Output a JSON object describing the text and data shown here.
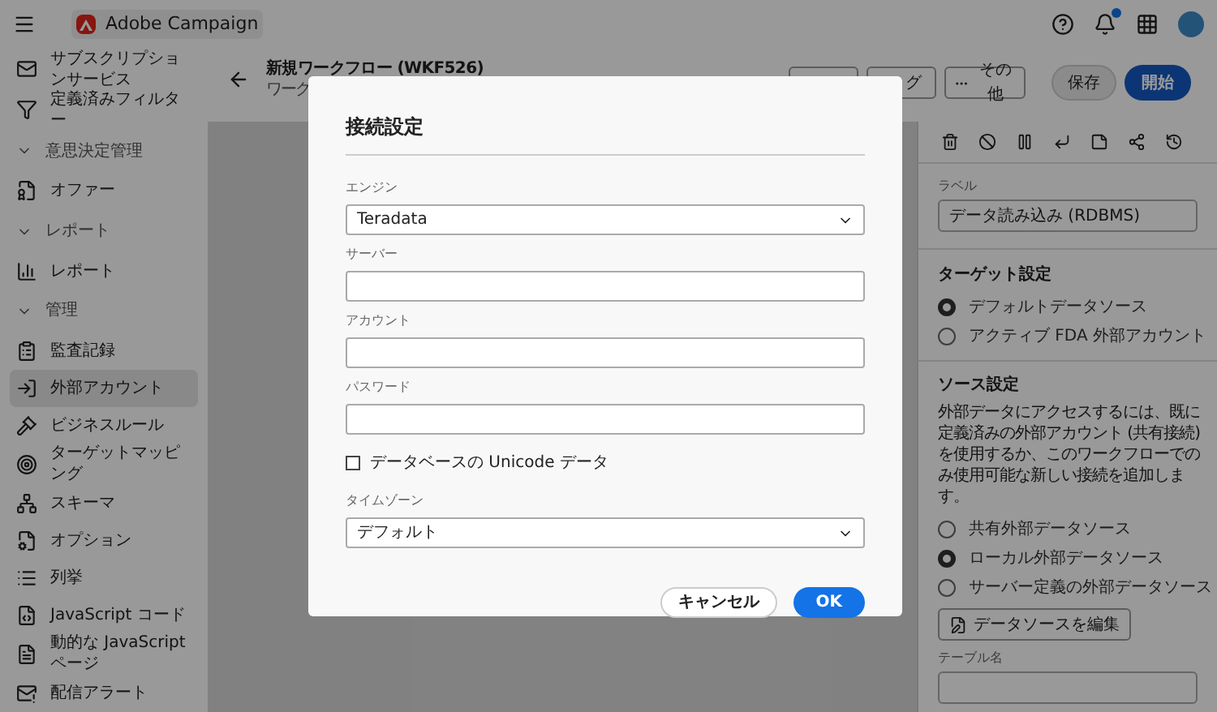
{
  "topbar": {
    "product": "Adobe Campaign",
    "notifications_badge": true
  },
  "sidebar": {
    "items": [
      {
        "kind": "item",
        "label": "サブスクリプションサービス",
        "selected": false
      },
      {
        "kind": "item",
        "label": "定義済みフィルター",
        "selected": false
      },
      {
        "kind": "section",
        "label": "意思決定管理"
      },
      {
        "kind": "item",
        "label": "オファー",
        "selected": false
      },
      {
        "kind": "section",
        "label": "レポート"
      },
      {
        "kind": "item",
        "label": "レポート",
        "selected": false
      },
      {
        "kind": "section",
        "label": "管理"
      },
      {
        "kind": "item",
        "label": "監査記録",
        "selected": false
      },
      {
        "kind": "item",
        "label": "外部アカウント",
        "selected": true
      },
      {
        "kind": "item",
        "label": "ビジネスルール",
        "selected": false
      },
      {
        "kind": "item",
        "label": "ターゲットマッピング",
        "selected": false
      },
      {
        "kind": "item",
        "label": "スキーマ",
        "selected": false
      },
      {
        "kind": "item",
        "label": "オプション",
        "selected": false
      },
      {
        "kind": "item",
        "label": "列挙",
        "selected": false
      },
      {
        "kind": "item",
        "label": "JavaScript コード",
        "selected": false
      },
      {
        "kind": "item",
        "label": "動的な JavaScript ページ",
        "selected": false
      },
      {
        "kind": "item",
        "label": "配信アラート",
        "selected": false
      }
    ]
  },
  "header": {
    "title": "新規ワークフロー (WKF526)",
    "subtitle": "ワーク",
    "buttons": [
      {
        "kind": "outline"
      },
      {
        "kind": "outline",
        "label": "グ"
      },
      {
        "kind": "more",
        "label": "その他"
      },
      {
        "kind": "secondary",
        "label": "保存"
      },
      {
        "kind": "primary",
        "label": "開始"
      }
    ]
  },
  "panel": {
    "label_field": {
      "label": "ラベル",
      "value": "データ読み込み (RDBMS)"
    },
    "target": {
      "title": "ターゲット設定",
      "options": [
        {
          "label": "デフォルトデータソース",
          "selected": true
        },
        {
          "label": "アクティブ FDA 外部アカウント",
          "selected": false
        }
      ]
    },
    "source": {
      "title": "ソース設定",
      "description": "外部データにアクセスするには、既に定義済みの外部アカウント (共有接続) を使用するか、このワークフローでのみ使用可能な新しい接続を追加します。",
      "options": [
        {
          "label": "共有外部データソース",
          "selected": false
        },
        {
          "label": "ローカル外部データソース",
          "selected": true
        },
        {
          "label": "サーバー定義の外部データソース",
          "selected": false
        }
      ],
      "edit_button": "データソースを編集"
    },
    "table_field": {
      "label": "テーブル名"
    }
  },
  "dialog": {
    "title": "接続設定",
    "fields": [
      {
        "kind": "select",
        "label": "エンジン",
        "value": "Teradata"
      },
      {
        "kind": "text",
        "label": "サーバー"
      },
      {
        "kind": "text",
        "label": "アカウント"
      },
      {
        "kind": "text",
        "label": "パスワード"
      },
      {
        "kind": "checkbox",
        "label": "データベースの Unicode データ",
        "checked": false
      },
      {
        "kind": "select",
        "label": "タイムゾーン",
        "value": "デフォルト"
      }
    ],
    "cancel": "キャンセル",
    "ok": "OK"
  }
}
